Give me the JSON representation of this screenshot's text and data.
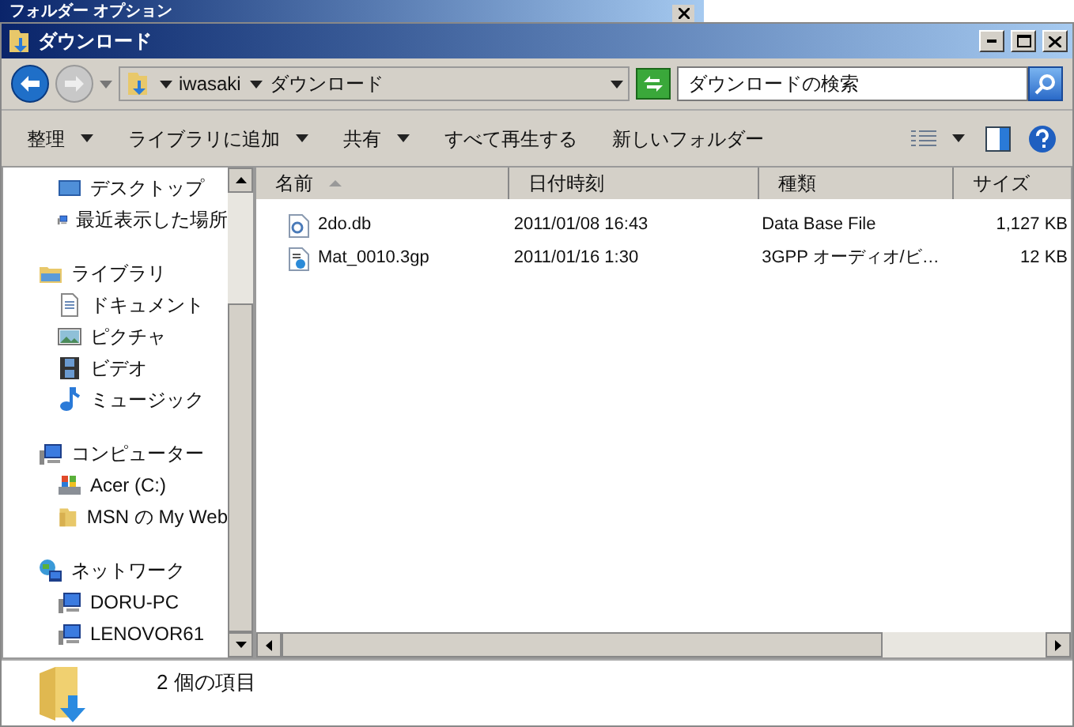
{
  "background_window": {
    "title": "フォルダー オプション"
  },
  "window": {
    "title": "ダウンロード"
  },
  "address_bar": {
    "path": [
      "iwasaki",
      "ダウンロード"
    ]
  },
  "search": {
    "placeholder": "ダウンロードの検索"
  },
  "toolbar": [
    {
      "label": "整理",
      "dropdown": true
    },
    {
      "label": "ライブラリに追加",
      "dropdown": true
    },
    {
      "label": "共有",
      "dropdown": true
    },
    {
      "label": "すべて再生する",
      "dropdown": false
    },
    {
      "label": "新しいフォルダー",
      "dropdown": false
    }
  ],
  "navigation": [
    {
      "items": [
        {
          "label": "デスクトップ",
          "kind": "desktop"
        },
        {
          "label": "最近表示した場所",
          "kind": "computer"
        }
      ]
    },
    {
      "label": "ライブラリ",
      "kind": "library",
      "children": [
        {
          "label": "ドキュメント",
          "kind": "document"
        },
        {
          "label": "ピクチャ",
          "kind": "picture"
        },
        {
          "label": "ビデオ",
          "kind": "video"
        },
        {
          "label": "ミュージック",
          "kind": "music"
        }
      ]
    },
    {
      "label": "コンピューター",
      "kind": "computer",
      "children": [
        {
          "label": "Acer (C:)",
          "kind": "drive"
        },
        {
          "label": "MSN の My Web",
          "kind": "folder"
        }
      ]
    },
    {
      "label": "ネットワーク",
      "kind": "network",
      "children": [
        {
          "label": "DORU-PC",
          "kind": "computer"
        },
        {
          "label": "LENOVOR61",
          "kind": "computer"
        }
      ]
    }
  ],
  "file_list": {
    "columns": [
      {
        "label": "名前",
        "sorted": true
      },
      {
        "label": "日付時刻",
        "sorted": false
      },
      {
        "label": "種類",
        "sorted": false
      },
      {
        "label": "サイズ",
        "sorted": false
      }
    ],
    "rows": [
      {
        "kind": "database",
        "name": "2do.db",
        "date": "2011/01/08 16:43",
        "type": "Data Base File",
        "size": "1,127 KB"
      },
      {
        "kind": "media",
        "name": "Mat_0010.3gp",
        "date": "2011/01/16 1:30",
        "type": "3GPP オーディオ/ビ…",
        "size": "12 KB"
      }
    ]
  },
  "status_bar": {
    "text": "2 個の項目"
  }
}
